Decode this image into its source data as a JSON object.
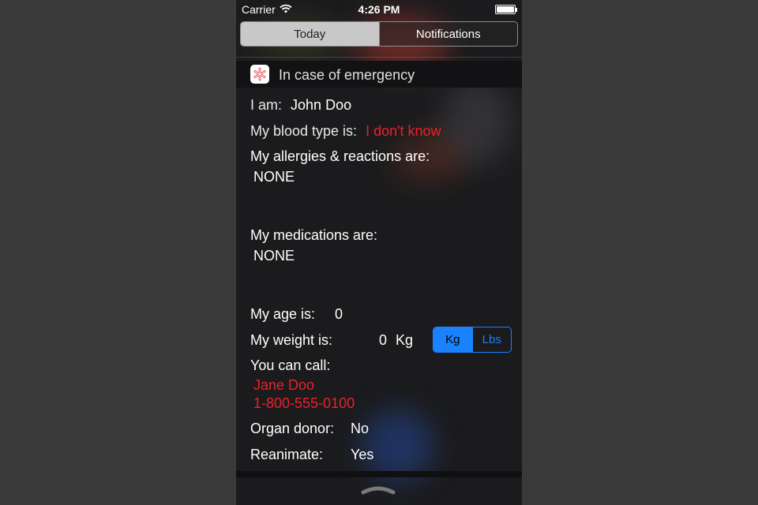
{
  "status_bar": {
    "carrier": "Carrier",
    "time": "4:26 PM"
  },
  "tabs": {
    "today": "Today",
    "notifications": "Notifications"
  },
  "widget": {
    "title": "In case of emergency",
    "icon": "medical-star-icon"
  },
  "info": {
    "i_am_label": "I am:",
    "name": "John Doo",
    "blood_label": "My blood type is:",
    "blood_value": "I don't know",
    "allergies_label": "My allergies & reactions are:",
    "allergies_value": "NONE",
    "medications_label": "My medications are:",
    "medications_value": "NONE",
    "age_label": "My age is:",
    "age_value": "0",
    "weight_label": "My weight is:",
    "weight_value": "0",
    "weight_unit": "Kg",
    "call_label": "You can call:",
    "contact_name": "Jane Doo",
    "contact_phone": "1-800-555-0100",
    "donor_label": "Organ donor:",
    "donor_value": "No",
    "reanimate_label": "Reanimate:",
    "reanimate_value": "Yes"
  },
  "unit_toggle": {
    "kg": "Kg",
    "lbs": "Lbs",
    "selected": "Kg"
  },
  "colors": {
    "accent": "#1a82ff",
    "alert": "#e8222a"
  }
}
